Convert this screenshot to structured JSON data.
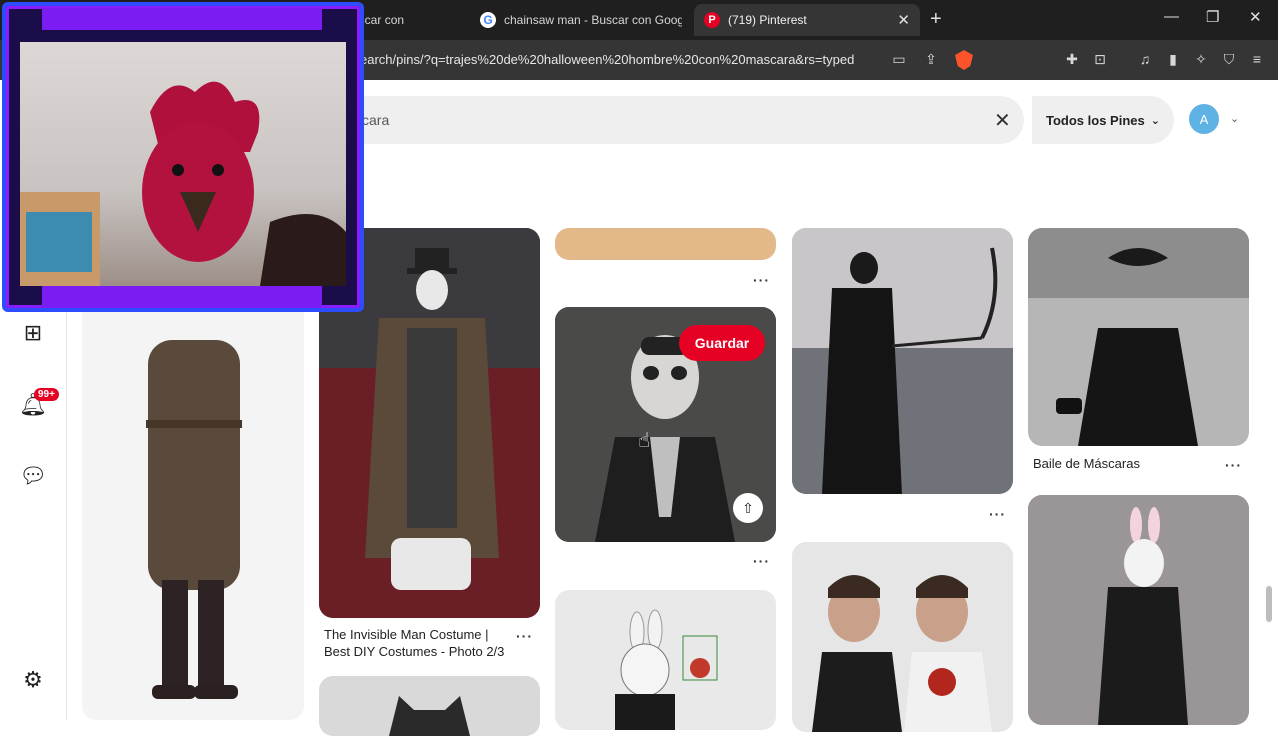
{
  "browser": {
    "tabs": [
      {
        "label": "ume - Buscar con",
        "favicon": "google-icon"
      },
      {
        "label": "chainsaw man - Buscar con Google",
        "favicon": "google-icon"
      },
      {
        "label": "(719) Pinterest",
        "favicon": "pinterest-icon",
        "active": true
      }
    ],
    "url": "earch/pins/?q=trajes%20de%20halloween%20hombre%20con%20mascara&rs=typed"
  },
  "header": {
    "search_value": "cara",
    "filter_label": "Todos los Pines",
    "avatar_letter": "A"
  },
  "rail": {
    "notifications_badge": "99+"
  },
  "pins": {
    "save_label": "Guardar",
    "invisible_man_title": "The Invisible Man Costume | Best DIY Costumes - Photo 2/3",
    "mask_ball_title": "Baile de Máscaras"
  },
  "colors": {
    "pinterest_red": "#e60023",
    "chrome_dark": "#1f1f1f",
    "overlay_purple": "#7a1cf2",
    "overlay_blue": "#2e4cff"
  }
}
